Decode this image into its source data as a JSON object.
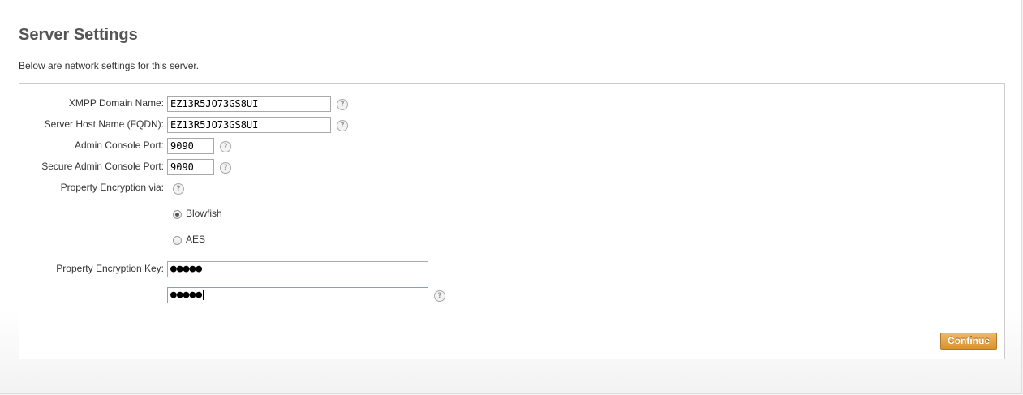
{
  "page": {
    "title": "Server Settings",
    "intro": "Below are network settings for this server."
  },
  "form": {
    "xmpp_domain": {
      "label": "XMPP Domain Name:",
      "value": "EZ13R5JO73GS8UI"
    },
    "server_host": {
      "label": "Server Host Name (FQDN):",
      "value": "EZ13R5JO73GS8UI"
    },
    "admin_port": {
      "label": "Admin Console Port:",
      "value": "9090"
    },
    "secure_admin_port": {
      "label": "Secure Admin Console Port:",
      "value": "9090"
    },
    "encryption": {
      "label": "Property Encryption via:",
      "options": [
        {
          "label": "Blowfish",
          "selected": true
        },
        {
          "label": "AES",
          "selected": false
        }
      ]
    },
    "encryption_key": {
      "label": "Property Encryption Key:",
      "masked_value": "●●●●●",
      "confirm_masked_value": "●●●●●"
    },
    "help_glyph": "?",
    "continue_label": "Continue"
  },
  "colors": {
    "button": "#d8932f",
    "focus_border": "#7da2ce"
  },
  "icons": [
    "help-icon",
    "radio-selected",
    "radio-unselected"
  ]
}
